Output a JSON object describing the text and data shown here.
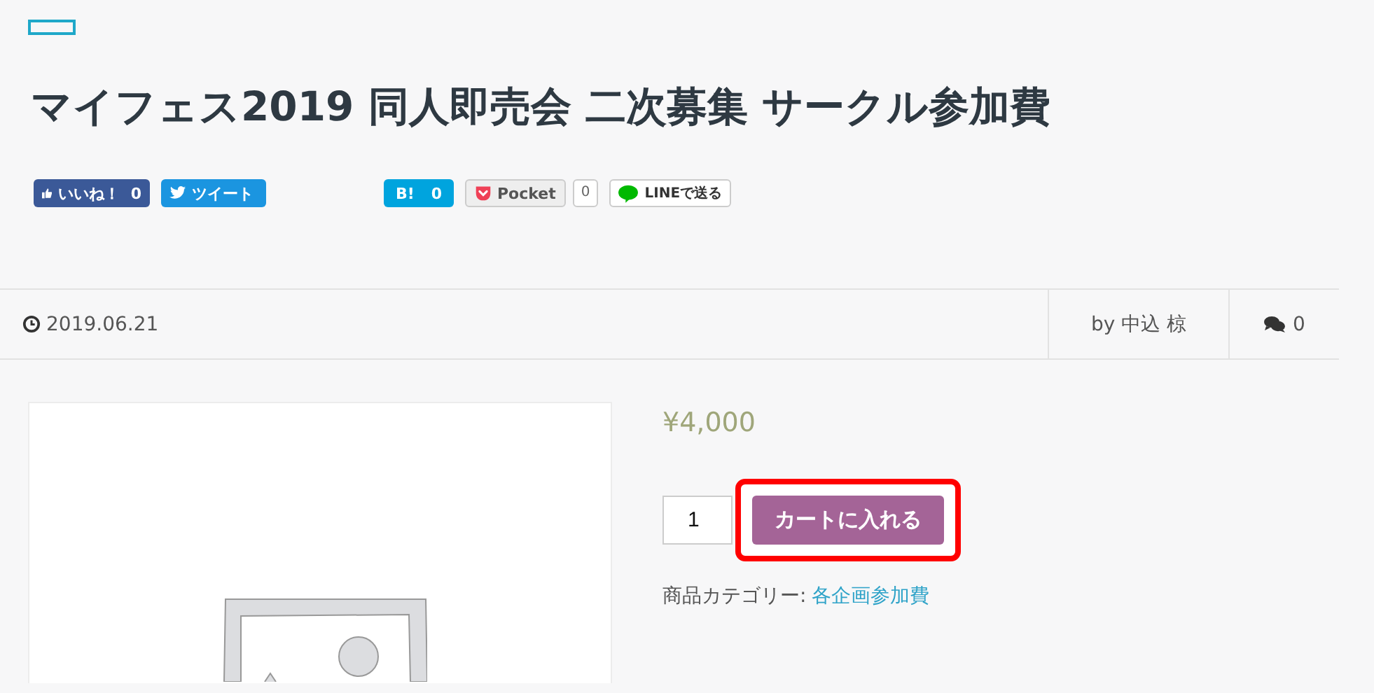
{
  "title": "マイフェス2019 同人即売会 二次募集 サークル参加費",
  "share_buttons": [
    {
      "kind": "facebook",
      "label": "いいね！",
      "count": "0"
    },
    {
      "kind": "twitter",
      "label": "ツイート"
    },
    {
      "kind": "hatena",
      "label": "B!",
      "count": "0"
    },
    {
      "kind": "pocket",
      "label": "Pocket",
      "count": "0"
    },
    {
      "kind": "line",
      "label": "LINEで送る"
    }
  ],
  "meta": {
    "date": "2019.06.21",
    "author": "by 中込 椋",
    "comments": "0"
  },
  "product": {
    "price": "¥4,000",
    "quantity": "1",
    "cart_button": "カートに入れる",
    "category_label": "商品カテゴリー:",
    "category_link": "各企画参加費"
  }
}
